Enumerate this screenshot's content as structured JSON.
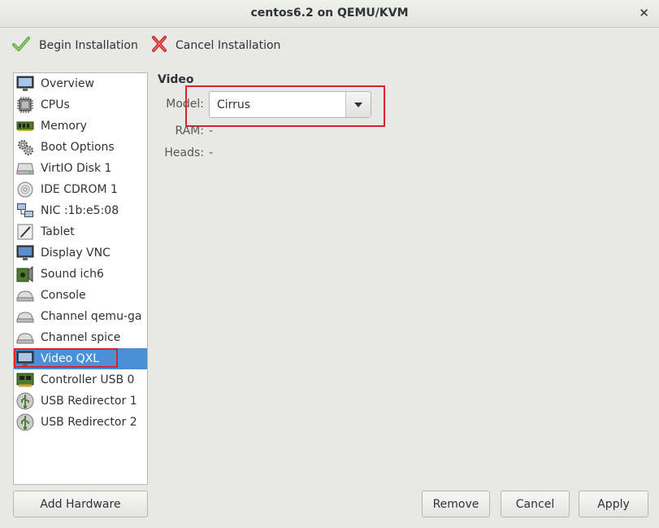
{
  "window": {
    "title": "centos6.2 on QEMU/KVM"
  },
  "toolbar": {
    "begin_label": "Begin Installation",
    "cancel_label": "Cancel Installation"
  },
  "sidebar": {
    "items": [
      {
        "label": "Overview",
        "icon": "monitor-icon"
      },
      {
        "label": "CPUs",
        "icon": "cpu-icon"
      },
      {
        "label": "Memory",
        "icon": "memory-icon"
      },
      {
        "label": "Boot Options",
        "icon": "gears-icon"
      },
      {
        "label": "VirtIO Disk 1",
        "icon": "disk-icon"
      },
      {
        "label": "IDE CDROM 1",
        "icon": "cdrom-icon"
      },
      {
        "label": "NIC :1b:e5:08",
        "icon": "network-icon"
      },
      {
        "label": "Tablet",
        "icon": "tablet-icon"
      },
      {
        "label": "Display VNC",
        "icon": "display-icon"
      },
      {
        "label": "Sound ich6",
        "icon": "sound-card-icon"
      },
      {
        "label": "Console",
        "icon": "serial-icon"
      },
      {
        "label": "Channel qemu-ga",
        "icon": "serial-icon"
      },
      {
        "label": "Channel spice",
        "icon": "serial-icon"
      },
      {
        "label": "Video QXL",
        "icon": "monitor-icon",
        "selected": true
      },
      {
        "label": "Controller USB 0",
        "icon": "pci-card-icon"
      },
      {
        "label": "USB Redirector 1",
        "icon": "usb-icon"
      },
      {
        "label": "USB Redirector 2",
        "icon": "usb-icon"
      }
    ]
  },
  "detail": {
    "section_title": "Video",
    "model_label": "Model:",
    "model_value": "Cirrus",
    "ram_label": "RAM:",
    "ram_value": "-",
    "heads_label": "Heads:",
    "heads_value": "-"
  },
  "buttons": {
    "add_hardware": "Add Hardware",
    "remove": "Remove",
    "cancel": "Cancel",
    "apply": "Apply"
  },
  "colors": {
    "selection": "#4a90d9",
    "highlight": "#d9242e"
  }
}
